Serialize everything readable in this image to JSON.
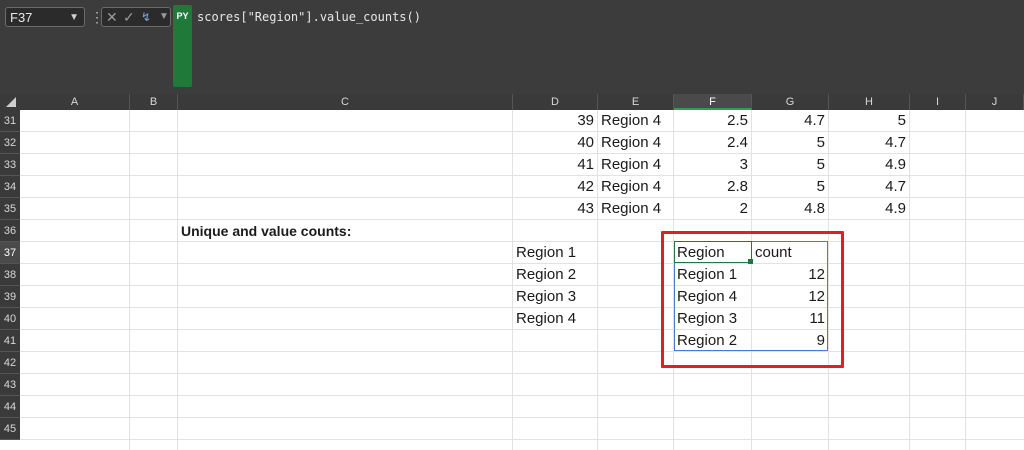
{
  "formula_bar": {
    "name_box": "F37",
    "py_badge": "PY",
    "formula": "scores[\"Region\"].value_counts()"
  },
  "columns": [
    "A",
    "B",
    "C",
    "D",
    "E",
    "F",
    "G",
    "H",
    "I",
    "J"
  ],
  "rows": [
    "31",
    "32",
    "33",
    "34",
    "35",
    "36",
    "37",
    "38",
    "39",
    "40",
    "41",
    "42",
    "43",
    "44",
    "45"
  ],
  "data_rows": [
    {
      "d": "39",
      "e": "Region 4",
      "f": "2.5",
      "g": "4.7",
      "h": "5"
    },
    {
      "d": "40",
      "e": "Region 4",
      "f": "2.4",
      "g": "5",
      "h": "4.7"
    },
    {
      "d": "41",
      "e": "Region 4",
      "f": "3",
      "g": "5",
      "h": "4.9"
    },
    {
      "d": "42",
      "e": "Region 4",
      "f": "2.8",
      "g": "5",
      "h": "4.7"
    },
    {
      "d": "43",
      "e": "Region 4",
      "f": "2",
      "g": "4.8",
      "h": "4.9"
    }
  ],
  "section_label": "Unique and value counts:",
  "unique_values": [
    "Region 1",
    "Region 2",
    "Region 3",
    "Region 4"
  ],
  "value_counts": {
    "header": {
      "region": "Region",
      "count": "count"
    },
    "rows": [
      {
        "region": "Region 1",
        "count": "12"
      },
      {
        "region": "Region 4",
        "count": "12"
      },
      {
        "region": "Region 3",
        "count": "11"
      },
      {
        "region": "Region 2",
        "count": "9"
      }
    ]
  }
}
